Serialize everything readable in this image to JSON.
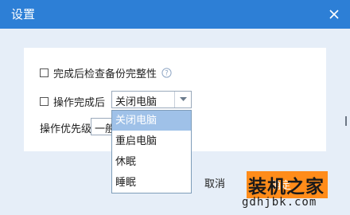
{
  "window": {
    "title": "设置",
    "accent": "#2d7fd6"
  },
  "options": {
    "verify_label": "完成后检查备份完整性",
    "verify_checked": false,
    "after_label": "操作完成后",
    "after_checked": false,
    "after_value": "关闭电脑",
    "priority_label": "操作优先级",
    "priority_value": "一般"
  },
  "dropdown": {
    "items": [
      "关闭电脑",
      "重启电脑",
      "休眠",
      "睡眠"
    ],
    "selected_index": 0
  },
  "buttons": {
    "cancel": "取消",
    "ok": "确定"
  },
  "watermark": {
    "text": "装机之家",
    "url": "gdhjbk.com"
  },
  "icons": {
    "close": "close-icon",
    "help": "help-icon",
    "dropdown_arrow": "chevron-down-icon"
  }
}
